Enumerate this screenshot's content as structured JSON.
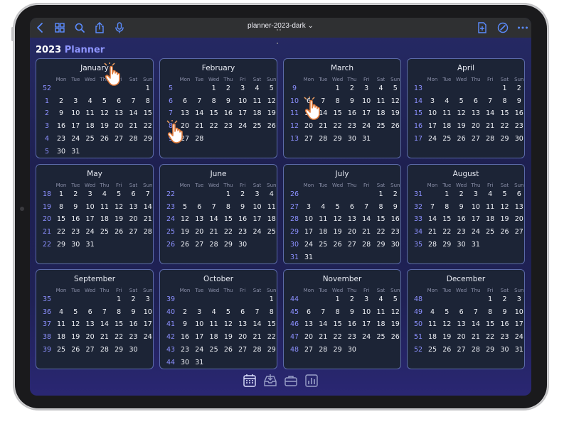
{
  "toolbar": {
    "doc_title": "planner-2023-dark ⌄",
    "left_icons": [
      "chevron-left-icon",
      "grid-icon",
      "search-icon",
      "share-icon",
      "microphone-icon"
    ],
    "right_icons": [
      "new-page-icon",
      "pen-icon",
      "more-icon"
    ]
  },
  "header": {
    "year": "2023",
    "word": "Planner"
  },
  "weekday_labels": [
    "Mon",
    "Tue",
    "Wed",
    "Thu",
    "Fri",
    "Sat",
    "Sun"
  ],
  "months": [
    {
      "name": "January",
      "rows": [
        {
          "wk": "52",
          "start": 6,
          "days": [
            "1"
          ]
        },
        {
          "wk": "1",
          "start": 0,
          "days": [
            "2",
            "3",
            "4",
            "5",
            "6",
            "7",
            "8"
          ]
        },
        {
          "wk": "2",
          "start": 0,
          "days": [
            "9",
            "10",
            "11",
            "12",
            "13",
            "14",
            "15"
          ]
        },
        {
          "wk": "3",
          "start": 0,
          "days": [
            "16",
            "17",
            "18",
            "19",
            "20",
            "21",
            "22"
          ]
        },
        {
          "wk": "4",
          "start": 0,
          "days": [
            "23",
            "24",
            "25",
            "26",
            "27",
            "28",
            "29"
          ]
        },
        {
          "wk": "5",
          "start": 0,
          "days": [
            "30",
            "31"
          ]
        }
      ]
    },
    {
      "name": "February",
      "rows": [
        {
          "wk": "5",
          "start": 2,
          "days": [
            "1",
            "2",
            "3",
            "4",
            "5"
          ]
        },
        {
          "wk": "6",
          "start": 0,
          "days": [
            "6",
            "7",
            "8",
            "9",
            "10",
            "11",
            "12"
          ]
        },
        {
          "wk": "7",
          "start": 0,
          "days": [
            "13",
            "14",
            "15",
            "16",
            "17",
            "18",
            "19"
          ]
        },
        {
          "wk": "8",
          "start": 0,
          "days": [
            "20",
            "21",
            "22",
            "23",
            "24",
            "25",
            "26"
          ]
        },
        {
          "wk": "9",
          "start": 0,
          "days": [
            "27",
            "28"
          ]
        }
      ]
    },
    {
      "name": "March",
      "rows": [
        {
          "wk": "9",
          "start": 2,
          "days": [
            "1",
            "2",
            "3",
            "4",
            "5"
          ]
        },
        {
          "wk": "10",
          "start": 0,
          "days": [
            "6",
            "7",
            "8",
            "9",
            "10",
            "11",
            "12"
          ]
        },
        {
          "wk": "11",
          "start": 0,
          "days": [
            "13",
            "14",
            "15",
            "16",
            "17",
            "18",
            "19"
          ]
        },
        {
          "wk": "12",
          "start": 0,
          "days": [
            "20",
            "21",
            "22",
            "23",
            "24",
            "25",
            "26"
          ]
        },
        {
          "wk": "13",
          "start": 0,
          "days": [
            "27",
            "28",
            "29",
            "30",
            "31"
          ]
        }
      ]
    },
    {
      "name": "April",
      "rows": [
        {
          "wk": "13",
          "start": 5,
          "days": [
            "1",
            "2"
          ]
        },
        {
          "wk": "14",
          "start": 0,
          "days": [
            "3",
            "4",
            "5",
            "6",
            "7",
            "8",
            "9"
          ]
        },
        {
          "wk": "15",
          "start": 0,
          "days": [
            "10",
            "11",
            "12",
            "13",
            "14",
            "15",
            "16"
          ]
        },
        {
          "wk": "16",
          "start": 0,
          "days": [
            "17",
            "18",
            "19",
            "20",
            "21",
            "22",
            "23"
          ]
        },
        {
          "wk": "17",
          "start": 0,
          "days": [
            "24",
            "25",
            "26",
            "27",
            "28",
            "29",
            "30"
          ]
        }
      ]
    },
    {
      "name": "May",
      "rows": [
        {
          "wk": "18",
          "start": 0,
          "days": [
            "1",
            "2",
            "3",
            "4",
            "5",
            "6",
            "7"
          ]
        },
        {
          "wk": "19",
          "start": 0,
          "days": [
            "8",
            "9",
            "10",
            "11",
            "12",
            "13",
            "14"
          ]
        },
        {
          "wk": "20",
          "start": 0,
          "days": [
            "15",
            "16",
            "17",
            "18",
            "19",
            "20",
            "21"
          ]
        },
        {
          "wk": "21",
          "start": 0,
          "days": [
            "22",
            "23",
            "24",
            "25",
            "26",
            "27",
            "28"
          ]
        },
        {
          "wk": "22",
          "start": 0,
          "days": [
            "29",
            "30",
            "31"
          ]
        }
      ]
    },
    {
      "name": "June",
      "rows": [
        {
          "wk": "22",
          "start": 3,
          "days": [
            "1",
            "2",
            "3",
            "4"
          ]
        },
        {
          "wk": "23",
          "start": 0,
          "days": [
            "5",
            "6",
            "7",
            "8",
            "9",
            "10",
            "11"
          ]
        },
        {
          "wk": "24",
          "start": 0,
          "days": [
            "12",
            "13",
            "14",
            "15",
            "16",
            "17",
            "18"
          ]
        },
        {
          "wk": "25",
          "start": 0,
          "days": [
            "19",
            "20",
            "21",
            "22",
            "23",
            "24",
            "25"
          ]
        },
        {
          "wk": "26",
          "start": 0,
          "days": [
            "26",
            "27",
            "28",
            "29",
            "30"
          ]
        }
      ]
    },
    {
      "name": "July",
      "rows": [
        {
          "wk": "26",
          "start": 5,
          "days": [
            "1",
            "2"
          ]
        },
        {
          "wk": "27",
          "start": 0,
          "days": [
            "3",
            "4",
            "5",
            "6",
            "7",
            "8",
            "9"
          ]
        },
        {
          "wk": "28",
          "start": 0,
          "days": [
            "10",
            "11",
            "12",
            "13",
            "14",
            "15",
            "16"
          ]
        },
        {
          "wk": "29",
          "start": 0,
          "days": [
            "17",
            "18",
            "19",
            "20",
            "21",
            "22",
            "23"
          ]
        },
        {
          "wk": "30",
          "start": 0,
          "days": [
            "24",
            "25",
            "26",
            "27",
            "28",
            "29",
            "30"
          ]
        },
        {
          "wk": "31",
          "start": 0,
          "days": [
            "31"
          ]
        }
      ]
    },
    {
      "name": "August",
      "rows": [
        {
          "wk": "31",
          "start": 1,
          "days": [
            "1",
            "2",
            "3",
            "4",
            "5",
            "6"
          ]
        },
        {
          "wk": "32",
          "start": 0,
          "days": [
            "7",
            "8",
            "9",
            "10",
            "11",
            "12",
            "13"
          ]
        },
        {
          "wk": "33",
          "start": 0,
          "days": [
            "14",
            "15",
            "16",
            "17",
            "18",
            "19",
            "20"
          ]
        },
        {
          "wk": "34",
          "start": 0,
          "days": [
            "21",
            "22",
            "23",
            "24",
            "25",
            "26",
            "27"
          ]
        },
        {
          "wk": "35",
          "start": 0,
          "days": [
            "28",
            "29",
            "30",
            "31"
          ]
        }
      ]
    },
    {
      "name": "September",
      "rows": [
        {
          "wk": "35",
          "start": 4,
          "days": [
            "1",
            "2",
            "3"
          ]
        },
        {
          "wk": "36",
          "start": 0,
          "days": [
            "4",
            "5",
            "6",
            "7",
            "8",
            "9",
            "10"
          ]
        },
        {
          "wk": "37",
          "start": 0,
          "days": [
            "11",
            "12",
            "13",
            "14",
            "15",
            "16",
            "17"
          ]
        },
        {
          "wk": "38",
          "start": 0,
          "days": [
            "18",
            "19",
            "20",
            "21",
            "22",
            "23",
            "24"
          ]
        },
        {
          "wk": "39",
          "start": 0,
          "days": [
            "25",
            "26",
            "27",
            "28",
            "29",
            "30"
          ]
        }
      ]
    },
    {
      "name": "October",
      "rows": [
        {
          "wk": "39",
          "start": 6,
          "days": [
            "1"
          ]
        },
        {
          "wk": "40",
          "start": 0,
          "days": [
            "2",
            "3",
            "4",
            "5",
            "6",
            "7",
            "8"
          ]
        },
        {
          "wk": "41",
          "start": 0,
          "days": [
            "9",
            "10",
            "11",
            "12",
            "13",
            "14",
            "15"
          ]
        },
        {
          "wk": "42",
          "start": 0,
          "days": [
            "16",
            "17",
            "18",
            "19",
            "20",
            "21",
            "22"
          ]
        },
        {
          "wk": "43",
          "start": 0,
          "days": [
            "23",
            "24",
            "25",
            "26",
            "27",
            "28",
            "29"
          ]
        },
        {
          "wk": "44",
          "start": 0,
          "days": [
            "30",
            "31"
          ]
        }
      ]
    },
    {
      "name": "November",
      "rows": [
        {
          "wk": "44",
          "start": 2,
          "days": [
            "1",
            "2",
            "3",
            "4",
            "5"
          ]
        },
        {
          "wk": "45",
          "start": 0,
          "days": [
            "6",
            "7",
            "8",
            "9",
            "10",
            "11",
            "12"
          ]
        },
        {
          "wk": "46",
          "start": 0,
          "days": [
            "13",
            "14",
            "15",
            "16",
            "17",
            "18",
            "19"
          ]
        },
        {
          "wk": "47",
          "start": 0,
          "days": [
            "20",
            "21",
            "22",
            "23",
            "24",
            "25",
            "26"
          ]
        },
        {
          "wk": "48",
          "start": 0,
          "days": [
            "27",
            "28",
            "29",
            "30"
          ]
        }
      ]
    },
    {
      "name": "December",
      "rows": [
        {
          "wk": "48",
          "start": 4,
          "days": [
            "1",
            "2",
            "3"
          ]
        },
        {
          "wk": "49",
          "start": 0,
          "days": [
            "4",
            "5",
            "6",
            "7",
            "8",
            "9",
            "10"
          ]
        },
        {
          "wk": "50",
          "start": 0,
          "days": [
            "11",
            "12",
            "13",
            "14",
            "15",
            "16",
            "17"
          ]
        },
        {
          "wk": "51",
          "start": 0,
          "days": [
            "18",
            "19",
            "20",
            "21",
            "22",
            "23",
            "24"
          ]
        },
        {
          "wk": "52",
          "start": 0,
          "days": [
            "25",
            "26",
            "27",
            "28",
            "29",
            "30",
            "31"
          ]
        }
      ]
    }
  ],
  "tabbar": {
    "icons": [
      "calendar-icon",
      "inbox-icon",
      "briefcase-icon",
      "chart-icon"
    ],
    "active": "calendar-icon"
  },
  "colors": {
    "accent": "#5b8cff",
    "week_number": "#8c90ff",
    "card_bg": "#1c2436",
    "card_border": "#5b6aa8",
    "title_accent": "#8e95ff"
  },
  "overlays": [
    "tap-hand-cursor-icon",
    "tap-hand-cursor-icon",
    "tap-hand-cursor-icon"
  ]
}
